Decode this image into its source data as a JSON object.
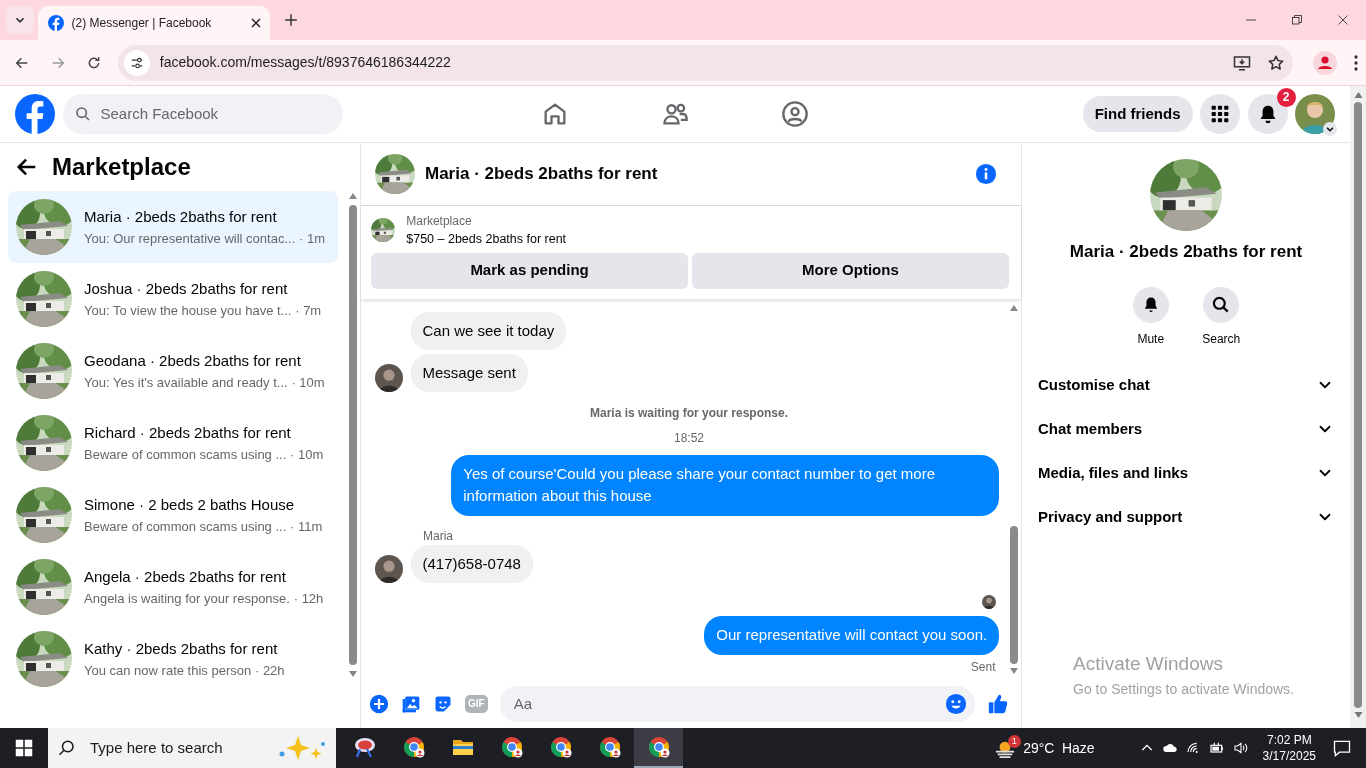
{
  "browser": {
    "tabs": [
      {
        "title": "(2) Messenger | Facebook",
        "selected": true
      }
    ],
    "url": "facebook.com/messages/t/8937646186344222"
  },
  "header": {
    "search_placeholder": "Search Facebook",
    "find_friends": "Find friends",
    "notification_count": "2"
  },
  "sidebar": {
    "title": "Marketplace",
    "conversations": [
      {
        "name": "Maria · 2beds 2baths for rent",
        "preview": "You: Our representative will contac...",
        "time": "· 1m",
        "selected": true
      },
      {
        "name": "Joshua · 2beds 2baths for rent",
        "preview": "You: To view the house you have t...",
        "time": "· 7m",
        "selected": false
      },
      {
        "name": "Geodana · 2beds 2baths for rent",
        "preview": "You: Yes it's available and ready t...",
        "time": "· 10m",
        "selected": false
      },
      {
        "name": "Richard · 2beds 2baths for rent",
        "preview": "Beware of common scams using ...",
        "time": "· 10m",
        "selected": false
      },
      {
        "name": "Simone · 2 beds 2 baths House",
        "preview": "Beware of common scams using ...",
        "time": "· 11m",
        "selected": false
      },
      {
        "name": "Angela · 2beds 2baths for rent",
        "preview": "Angela is waiting for your response.",
        "time": "· 12h",
        "selected": false
      },
      {
        "name": "Kathy · 2beds 2baths for rent",
        "preview": "You can now rate this person",
        "time": "· 22h",
        "selected": false
      }
    ]
  },
  "chat": {
    "title": "Maria · 2beds 2baths for rent",
    "listing": {
      "label": "Marketplace",
      "text": "$750 – 2beds 2baths for rent"
    },
    "buttons": [
      "Mark as pending",
      "More Options"
    ],
    "messages": [
      {
        "kind": "incoming",
        "text": "Can we see it today",
        "avatar": false
      },
      {
        "kind": "incoming",
        "text": "Message sent",
        "avatar": true
      },
      {
        "kind": "notice",
        "text": "Maria is waiting for your response."
      },
      {
        "kind": "time",
        "text": "18:52"
      },
      {
        "kind": "outgoing",
        "text": "Yes of course'Could you please share your contact number to get more information about this house"
      },
      {
        "kind": "sender",
        "text": "Maria"
      },
      {
        "kind": "incoming",
        "text": "(417)658-0748",
        "avatar": true
      },
      {
        "kind": "seen"
      },
      {
        "kind": "outgoing",
        "text": "Our representative will contact you soon."
      },
      {
        "kind": "status",
        "text": "Sent"
      }
    ],
    "composer": {
      "placeholder": "Aa",
      "gif_label": "GIF"
    }
  },
  "details": {
    "title": "Maria · 2beds 2baths for rent",
    "actions": [
      {
        "label": "Mute"
      },
      {
        "label": "Search"
      }
    ],
    "sections": [
      "Customise chat",
      "Chat members",
      "Media, files and links",
      "Privacy and support"
    ]
  },
  "watermark": {
    "title": "Activate Windows",
    "subtitle": "Go to Settings to activate Windows."
  },
  "taskbar": {
    "search_placeholder": "Type here to search",
    "apps": [
      {
        "kind": "snip",
        "selected": false
      },
      {
        "kind": "chrome",
        "selected": false
      },
      {
        "kind": "folder",
        "selected": false
      },
      {
        "kind": "chrome",
        "selected": false
      },
      {
        "kind": "chrome",
        "selected": false
      },
      {
        "kind": "chrome",
        "selected": false
      },
      {
        "kind": "chrome",
        "selected": true
      }
    ],
    "weather": {
      "badge": "1",
      "temperature": "29°C",
      "condition": "Haze"
    },
    "time": "7:02 PM",
    "date": "3/17/2025"
  }
}
